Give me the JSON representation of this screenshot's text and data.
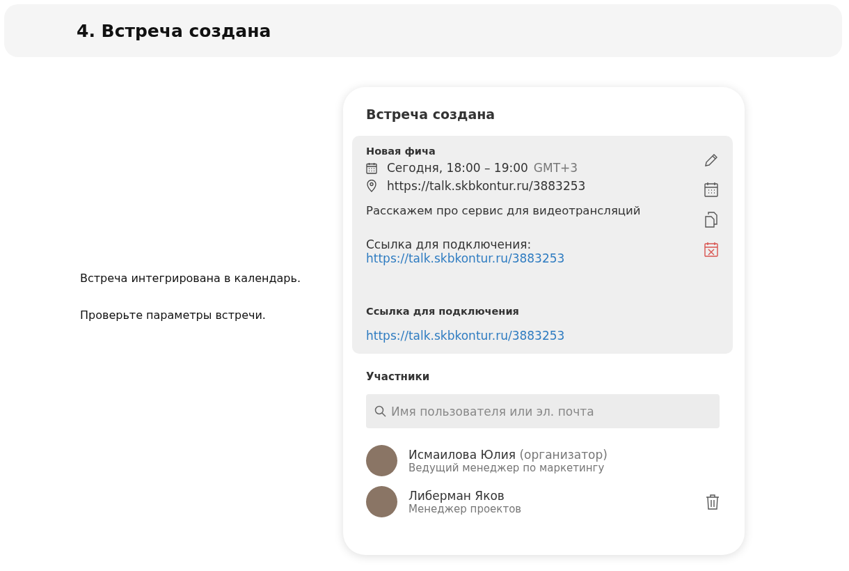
{
  "header": {
    "title": "4. Встреча создана"
  },
  "description": [
    "Встреча интегрирована в календарь.",
    "Проверьте параметры встречи."
  ],
  "card": {
    "title": "Встреча создана",
    "event": {
      "name": "Новая фича",
      "time": "Сегодня, 18:00 – 19:00",
      "timezone": "GMT+3",
      "location": "https://talk.skbkontur.ru/3883253",
      "about": "Расскажем про сервис для видеотрансляций",
      "link_label": "Ссылка для подключения:",
      "link": "https://talk.skbkontur.ru/3883253",
      "join_label": "Ссылка для подключения",
      "join_link": "https://talk.skbkontur.ru/3883253"
    },
    "participants_title": "Участники",
    "search": {
      "placeholder": "Имя пользователя или эл. почта"
    },
    "participants": [
      {
        "name": "Исмаилова Юлия",
        "note": "(организатор)",
        "position": "Ведущий менеджер по маркетингу",
        "deletable": false
      },
      {
        "name": "Либерман Яков",
        "position": "Менеджер проектов",
        "deletable": true
      }
    ]
  }
}
